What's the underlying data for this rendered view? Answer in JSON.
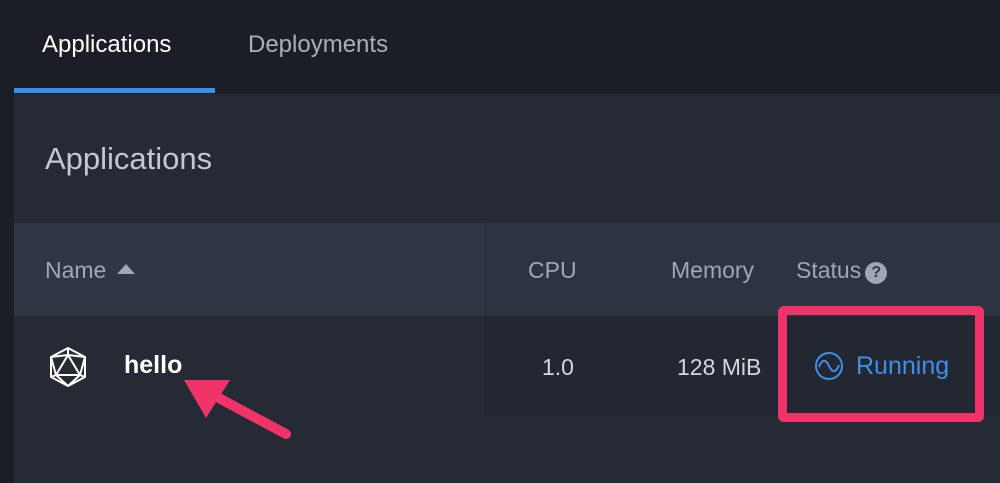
{
  "tabs": [
    {
      "label": "Applications",
      "active": true
    },
    {
      "label": "Deployments",
      "active": false
    }
  ],
  "panel": {
    "title": "Applications"
  },
  "table": {
    "columns": {
      "name": "Name",
      "cpu": "CPU",
      "memory": "Memory",
      "status": "Status"
    },
    "sort": {
      "column": "name",
      "direction": "ascending"
    },
    "rows": [
      {
        "name": "hello",
        "icon": "geodesic-icosahedron-icon",
        "cpu": "1.0",
        "memory": "128 MiB",
        "status": "Running",
        "status_icon": "wave-circle-icon"
      }
    ]
  },
  "colors": {
    "accent": "#3f8fe6",
    "annotation": "#f0346a",
    "background": "#1b1e26",
    "panel": "#252a35"
  }
}
